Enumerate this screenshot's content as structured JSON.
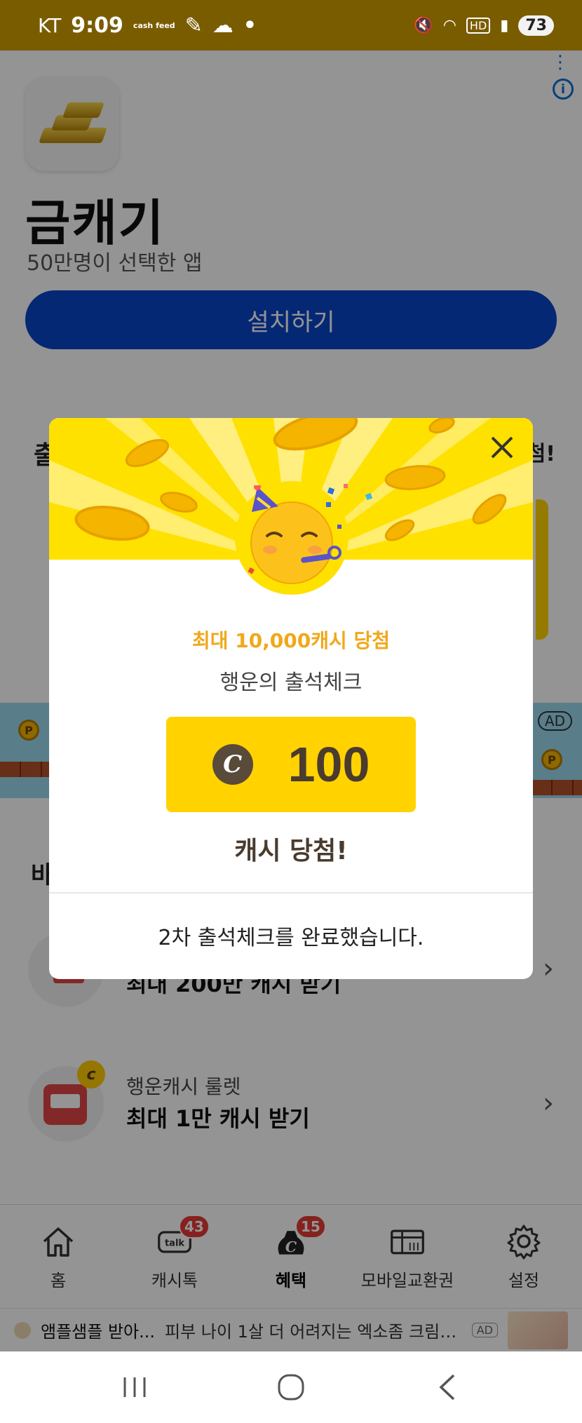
{
  "status_bar": {
    "carrier": "KT",
    "time": "9:09",
    "mini_app_label": "cash feed",
    "battery": "73"
  },
  "app": {
    "title": "금캐기",
    "subtitle": "50만명이 선택한 앱",
    "install_label": "설치하기"
  },
  "peek": {
    "left_char": "출",
    "right_text": "첨!",
    "section_char": "바"
  },
  "ad_banner": {
    "tag": "AD",
    "coin_letter": "P"
  },
  "list": [
    {
      "top": "",
      "main": "최대 200만 캐시 받기"
    },
    {
      "top": "행운캐시 룰렛",
      "main": "최대 1만 캐시 받기"
    }
  ],
  "bottom_nav": [
    {
      "label": "홈",
      "icon": "home-icon",
      "badge": ""
    },
    {
      "label": "캐시톡",
      "icon": "talk-icon",
      "badge": "43"
    },
    {
      "label": "혜택",
      "icon": "cash-bag-icon",
      "badge": "15",
      "active": true
    },
    {
      "label": "모바일교환권",
      "icon": "gift-card-icon",
      "badge": ""
    },
    {
      "label": "설정",
      "icon": "gear-icon",
      "badge": ""
    }
  ],
  "ad_strip": {
    "name": "앰플샘플 받아...",
    "text": "피부 나이 1살 더 어려지는 엑소좀 크림 최...",
    "chip": "AD"
  },
  "modal": {
    "promo": "최대 10,000캐시 당첨",
    "title": "행운의 출석체크",
    "coin_letter": "C",
    "amount": "100",
    "won": "캐시 당첨!",
    "complete": "2차 출석체크를 완료했습니다."
  },
  "colors": {
    "status_bar": "#7a5c00",
    "install_button": "#0a46c8",
    "modal_hero": "#ffe100",
    "promo_text": "#f0a81a",
    "reward_box": "#ffd200",
    "badge": "#e53935"
  }
}
